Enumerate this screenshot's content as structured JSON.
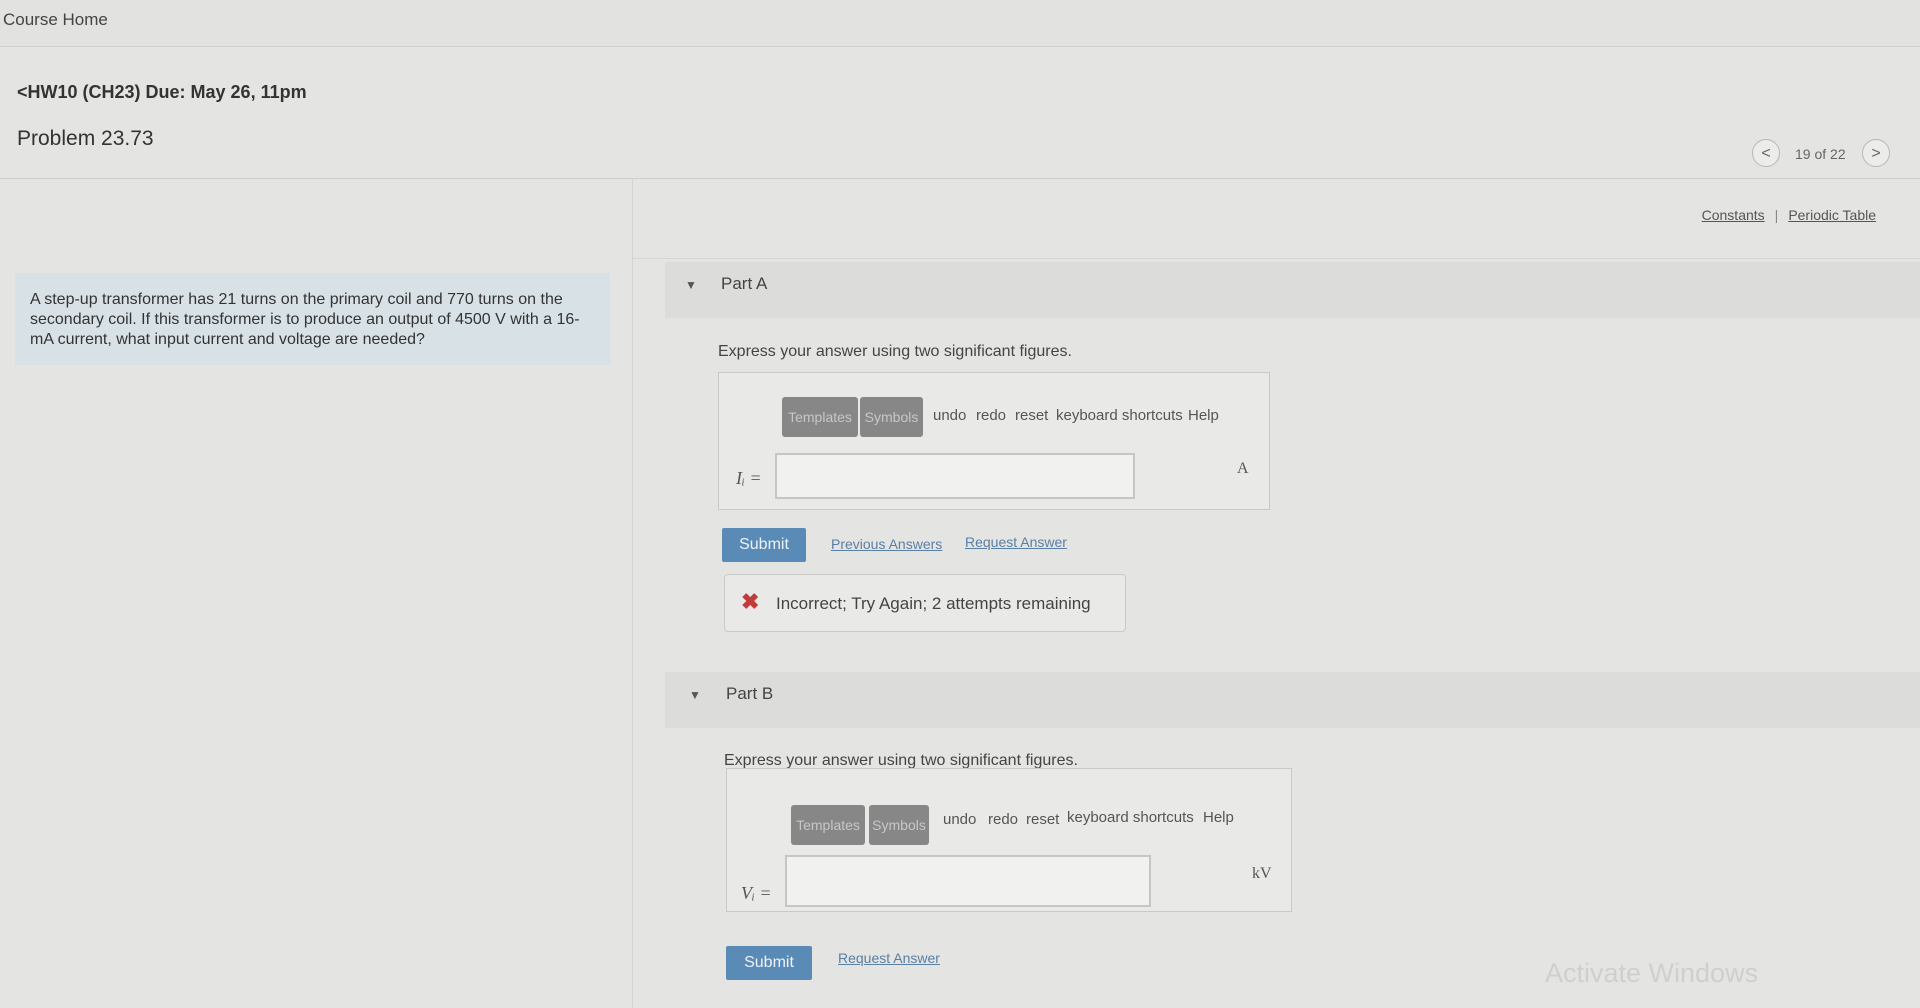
{
  "header": {
    "course_home": "Course Home",
    "assignment": "<HW10 (CH23) Due: May 26, 11pm",
    "problem_title": "Problem 23.73",
    "pager": {
      "prev": "<",
      "count": "19 of 22",
      "next": ">"
    },
    "links": {
      "constants": "Constants",
      "separator": "|",
      "periodic_table": "Periodic Table"
    }
  },
  "problem": {
    "text": "A step-up transformer has 21 turns on the primary coil and 770 turns on the secondary coil. If this transformer is to produce an output of 4500 V with a 16-mA current, what input current and voltage are needed?"
  },
  "parts": [
    {
      "label": "Part A",
      "instruction": "Express your answer using two significant figures.",
      "toolbar": {
        "templates": "Templates",
        "symbols": "Symbols",
        "undo": "undo",
        "redo": "redo",
        "reset": "reset",
        "shortcuts": "keyboard shortcuts",
        "help": "Help"
      },
      "variable": "Iᵢ =",
      "input_value": "",
      "unit": "A",
      "submit": "Submit",
      "previous_answers": "Previous Answers",
      "request_answer": "Request Answer",
      "feedback": {
        "icon": "✖",
        "message": "Incorrect; Try Again; 2 attempts remaining"
      }
    },
    {
      "label": "Part B",
      "instruction": "Express your answer using two significant figures.",
      "toolbar": {
        "templates": "Templates",
        "symbols": "Symbols",
        "undo": "undo",
        "redo": "redo",
        "reset": "reset",
        "shortcuts": "keyboard shortcuts",
        "help": "Help"
      },
      "variable": "Vᵢ =",
      "input_value": "",
      "unit": "kV",
      "submit": "Submit",
      "request_answer": "Request Answer"
    }
  ],
  "watermark": "Activate Windows"
}
